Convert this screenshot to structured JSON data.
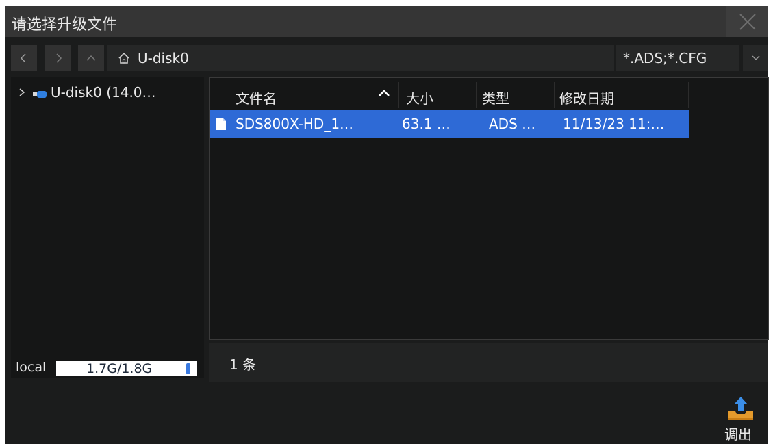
{
  "dialog": {
    "title": "请选择升级文件",
    "close_icon": "close-icon"
  },
  "toolbar": {
    "back_icon": "chevron-left-icon",
    "forward_icon": "chevron-right-icon",
    "up_icon": "chevron-up-icon",
    "home_icon": "home-icon",
    "path": "U-disk0",
    "filter": "*.ADS;*.CFG",
    "filter_dropdown_icon": "chevron-down-icon"
  },
  "tree": {
    "items": [
      {
        "label": "U-disk0  (14.0…",
        "icon": "usb-drive-icon",
        "expanded": false
      }
    ]
  },
  "storage": {
    "label": "local",
    "usage": "1.7G/1.8G",
    "fill_fraction": 0.94
  },
  "filelist": {
    "columns": [
      "文件名",
      "大小",
      "类型",
      "修改日期"
    ],
    "sorted_column": "文件名",
    "sort_direction": "ascending",
    "rows": [
      {
        "name": "SDS800X-HD_1…",
        "size": "63.1 …",
        "type": "ADS …",
        "modified": "11/13/23 11:…",
        "selected": true
      }
    ]
  },
  "status": {
    "count": "1 条"
  },
  "actions": {
    "eject_label": "调出",
    "eject_icon": "eject-tray-icon"
  },
  "colors": {
    "background": "#1b1c1c",
    "titlebar": "#353535",
    "selection": "#2e6ad6"
  }
}
